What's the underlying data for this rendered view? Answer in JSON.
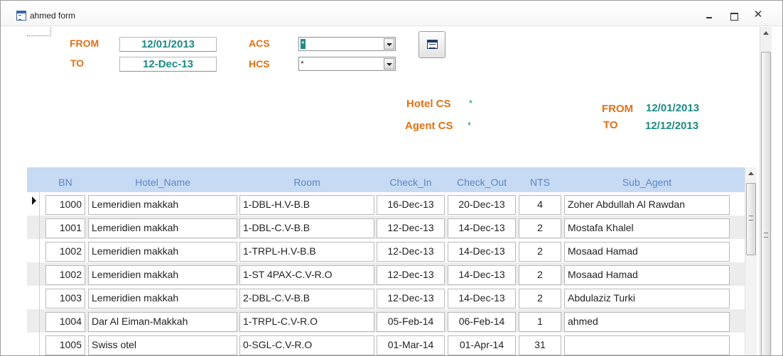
{
  "window": {
    "title": "ahmed form",
    "close_glyph": "✕"
  },
  "filters": {
    "from_label": "FROM",
    "from_value": "12/01/2013",
    "to_label": "TO",
    "to_value": "12-Dec-13",
    "acs_label": "ACS",
    "acs_value": "*",
    "hcs_label": "HCS",
    "hcs_value": "*"
  },
  "summary": {
    "hotel_cs_label": "Hotel CS",
    "hotel_cs_value": "*",
    "agent_cs_label": "Agent CS",
    "agent_cs_value": "*",
    "from_label": "FROM",
    "from_value": "12/01/2013",
    "to_label": "TO",
    "to_value": "12/12/2013"
  },
  "grid": {
    "columns": [
      "BN",
      "Hotel_Name",
      "Room",
      "Check_In",
      "Check_Out",
      "NTS",
      "Sub_Agent"
    ],
    "rows": [
      {
        "bn": "1000",
        "hotel": "Lemeridien makkah",
        "room": "1-DBL-H.V-B.B",
        "check_in": "16-Dec-13",
        "check_out": "20-Dec-13",
        "nts": "4",
        "sub_agent": "Zoher Abdullah Al Rawdan"
      },
      {
        "bn": "1001",
        "hotel": "Lemeridien makkah",
        "room": "1-DBL-C.V-B.B",
        "check_in": "12-Dec-13",
        "check_out": "14-Dec-13",
        "nts": "2",
        "sub_agent": "Mostafa Khalel"
      },
      {
        "bn": "1002",
        "hotel": "Lemeridien makkah",
        "room": "1-TRPL-H.V-B.B",
        "check_in": "12-Dec-13",
        "check_out": "14-Dec-13",
        "nts": "2",
        "sub_agent": "Mosaad Hamad"
      },
      {
        "bn": "1002",
        "hotel": "Lemeridien makkah",
        "room": "1-ST 4PAX-C.V-R.O",
        "check_in": "12-Dec-13",
        "check_out": "14-Dec-13",
        "nts": "2",
        "sub_agent": "Mosaad Hamad"
      },
      {
        "bn": "1003",
        "hotel": "Lemeridien makkah",
        "room": "2-DBL-C.V-B.B",
        "check_in": "12-Dec-13",
        "check_out": "14-Dec-13",
        "nts": "2",
        "sub_agent": "Abdulaziz Turki"
      },
      {
        "bn": "1004",
        "hotel": "Dar Al Eiman-Makkah",
        "room": "1-TRPL-C.V-R.O",
        "check_in": "05-Feb-14",
        "check_out": "06-Feb-14",
        "nts": "1",
        "sub_agent": "ahmed"
      },
      {
        "bn": "1005",
        "hotel": "Swiss otel",
        "room": "0-SGL-C.V-R.O",
        "check_in": "01-Mar-14",
        "check_out": "01-Apr-14",
        "nts": "31",
        "sub_agent": ""
      }
    ]
  },
  "colors": {
    "label_orange": "#e07012",
    "value_teal": "#1a8a86",
    "grid_header_bg": "#c7daf3",
    "grid_header_text": "#5a86c9",
    "alt_row_bg": "#ececec"
  },
  "icons": {
    "window": "form-window-icon",
    "button": "form-view-icon",
    "current_row": "record-pointer-icon"
  }
}
